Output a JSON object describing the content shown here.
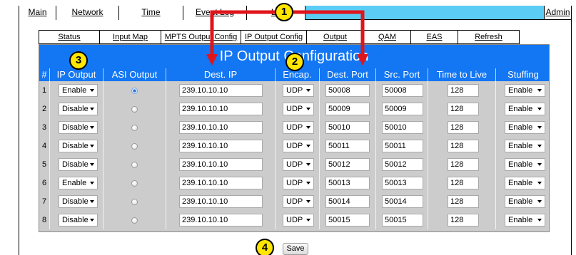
{
  "topnav": {
    "tabs": [
      "Main",
      "Network",
      "Time",
      "Event Log",
      "Lo"
    ],
    "admin": "Admin"
  },
  "subtabs": [
    "Status",
    "Input Map",
    "MPTS Output Config",
    "IP Output Config",
    "Output",
    "QAM",
    "EAS",
    "Refresh"
  ],
  "panel": {
    "title": "IP Output Configuration",
    "headers": [
      "#",
      "IP Output",
      "ASI Output",
      "Dest. IP",
      "Encap.",
      "Dest. Port",
      "Src. Port",
      "Time to Live",
      "Stuffing"
    ]
  },
  "rows": [
    {
      "num": "1",
      "ip_output": "Enable",
      "asi_on": true,
      "dest_ip": "239.10.10.10",
      "encap": "UDP",
      "dest_port": "50008",
      "src_port": "50008",
      "ttl": "128",
      "stuffing": "Enable"
    },
    {
      "num": "2",
      "ip_output": "Disable",
      "asi_on": false,
      "dest_ip": "239.10.10.10",
      "encap": "UDP",
      "dest_port": "50009",
      "src_port": "50009",
      "ttl": "128",
      "stuffing": "Enable"
    },
    {
      "num": "3",
      "ip_output": "Disable",
      "asi_on": false,
      "dest_ip": "239.10.10.10",
      "encap": "UDP",
      "dest_port": "50010",
      "src_port": "50010",
      "ttl": "128",
      "stuffing": "Enable"
    },
    {
      "num": "4",
      "ip_output": "Disable",
      "asi_on": false,
      "dest_ip": "239.10.10.10",
      "encap": "UDP",
      "dest_port": "50011",
      "src_port": "50011",
      "ttl": "128",
      "stuffing": "Enable"
    },
    {
      "num": "5",
      "ip_output": "Disable",
      "asi_on": false,
      "dest_ip": "239.10.10.10",
      "encap": "UDP",
      "dest_port": "50012",
      "src_port": "50012",
      "ttl": "128",
      "stuffing": "Enable"
    },
    {
      "num": "6",
      "ip_output": "Enable",
      "asi_on": false,
      "dest_ip": "239.10.10.10",
      "encap": "UDP",
      "dest_port": "50013",
      "src_port": "50013",
      "ttl": "128",
      "stuffing": "Enable"
    },
    {
      "num": "7",
      "ip_output": "Disable",
      "asi_on": false,
      "dest_ip": "239.10.10.10",
      "encap": "UDP",
      "dest_port": "50014",
      "src_port": "50014",
      "ttl": "128",
      "stuffing": "Enable"
    },
    {
      "num": "8",
      "ip_output": "Disable",
      "asi_on": false,
      "dest_ip": "239.10.10.10",
      "encap": "UDP",
      "dest_port": "50015",
      "src_port": "50015",
      "ttl": "128",
      "stuffing": "Enable"
    }
  ],
  "save_label": "Save",
  "callouts": [
    "1",
    "2",
    "3",
    "4"
  ],
  "colors": {
    "accent_blue": "#1376f3",
    "nav_fill": "#5bcdf4",
    "arrow_red": "#e0141b",
    "badge_yellow": "#ffe600"
  },
  "icons": {
    "dropdown": "chevron-down-icon",
    "radio": "radio-button-icon"
  }
}
